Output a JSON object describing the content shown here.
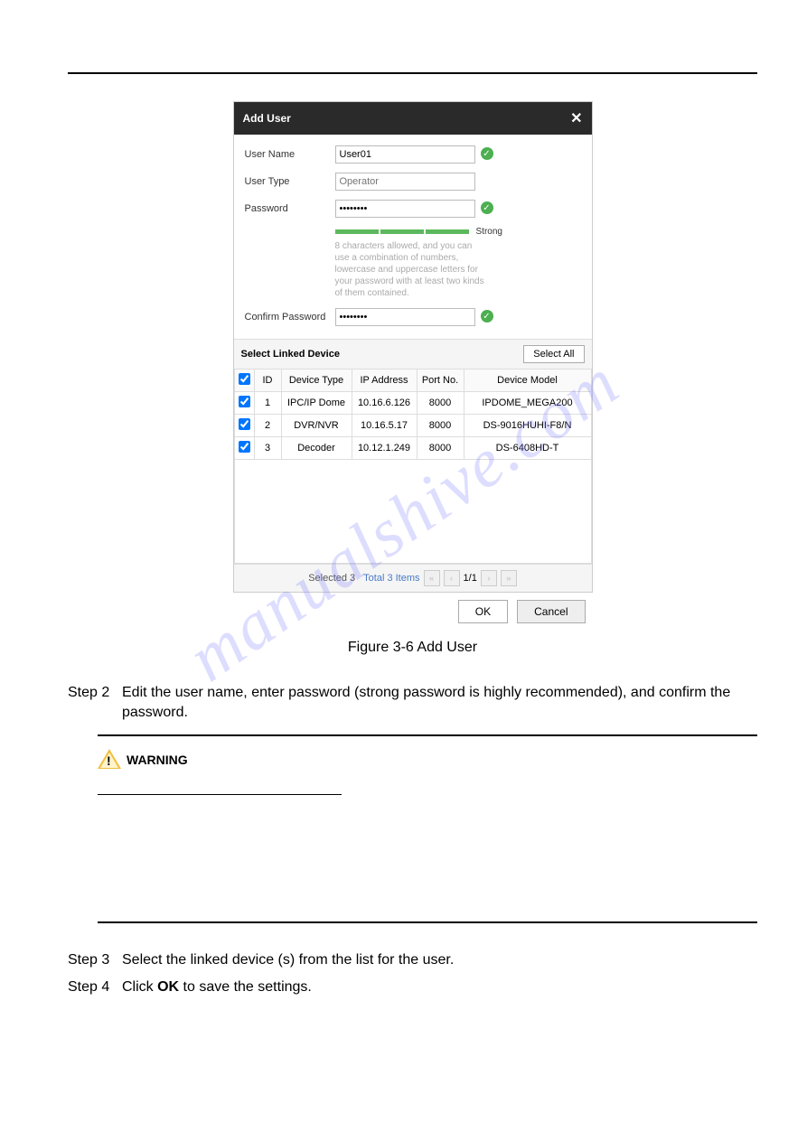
{
  "watermark": "manualshive.com",
  "dialog": {
    "title": "Add User",
    "labels": {
      "userName": "User Name",
      "userType": "User Type",
      "password": "Password",
      "confirmPassword": "Confirm Password"
    },
    "values": {
      "userName": "User01",
      "userTypePlaceholder": "Operator",
      "password": "••••••••",
      "confirmPassword": "••••••••"
    },
    "strengthLabel": "Strong",
    "hint": "8 characters allowed, and you can use a combination of numbers, lowercase and uppercase letters for your password with at least two kinds of them contained.",
    "linkedDevice": {
      "title": "Select Linked Device",
      "selectAll": "Select All",
      "headers": {
        "id": "ID",
        "deviceType": "Device Type",
        "ip": "IP Address",
        "port": "Port No.",
        "model": "Device Model"
      },
      "rows": [
        {
          "id": "1",
          "type": "IPC/IP Dome",
          "ip": "10.16.6.126",
          "port": "8000",
          "model": "IPDOME_MEGA200"
        },
        {
          "id": "2",
          "type": "DVR/NVR",
          "ip": "10.16.5.17",
          "port": "8000",
          "model": "DS-9016HUHI-F8/N"
        },
        {
          "id": "3",
          "type": "Decoder",
          "ip": "10.12.1.249",
          "port": "8000",
          "model": "DS-6408HD-T"
        }
      ],
      "pager": {
        "selected": "Selected 3",
        "total": "Total 3 Items",
        "page": "1/1"
      }
    },
    "buttons": {
      "ok": "OK",
      "cancel": "Cancel"
    }
  },
  "caption": "Figure 3-6 Add User",
  "steps": {
    "s2label": "Step 2",
    "s2text": "Edit the user name, enter password (strong password is highly recommended), and confirm the password.",
    "s3label": "Step 3",
    "s3text": "Select the linked device (s) from the list for the user.",
    "s4label": "Step 4",
    "s4textA": "Click ",
    "s4bold": "OK",
    "s4textB": " to save the settings."
  },
  "warning": "WARNING"
}
